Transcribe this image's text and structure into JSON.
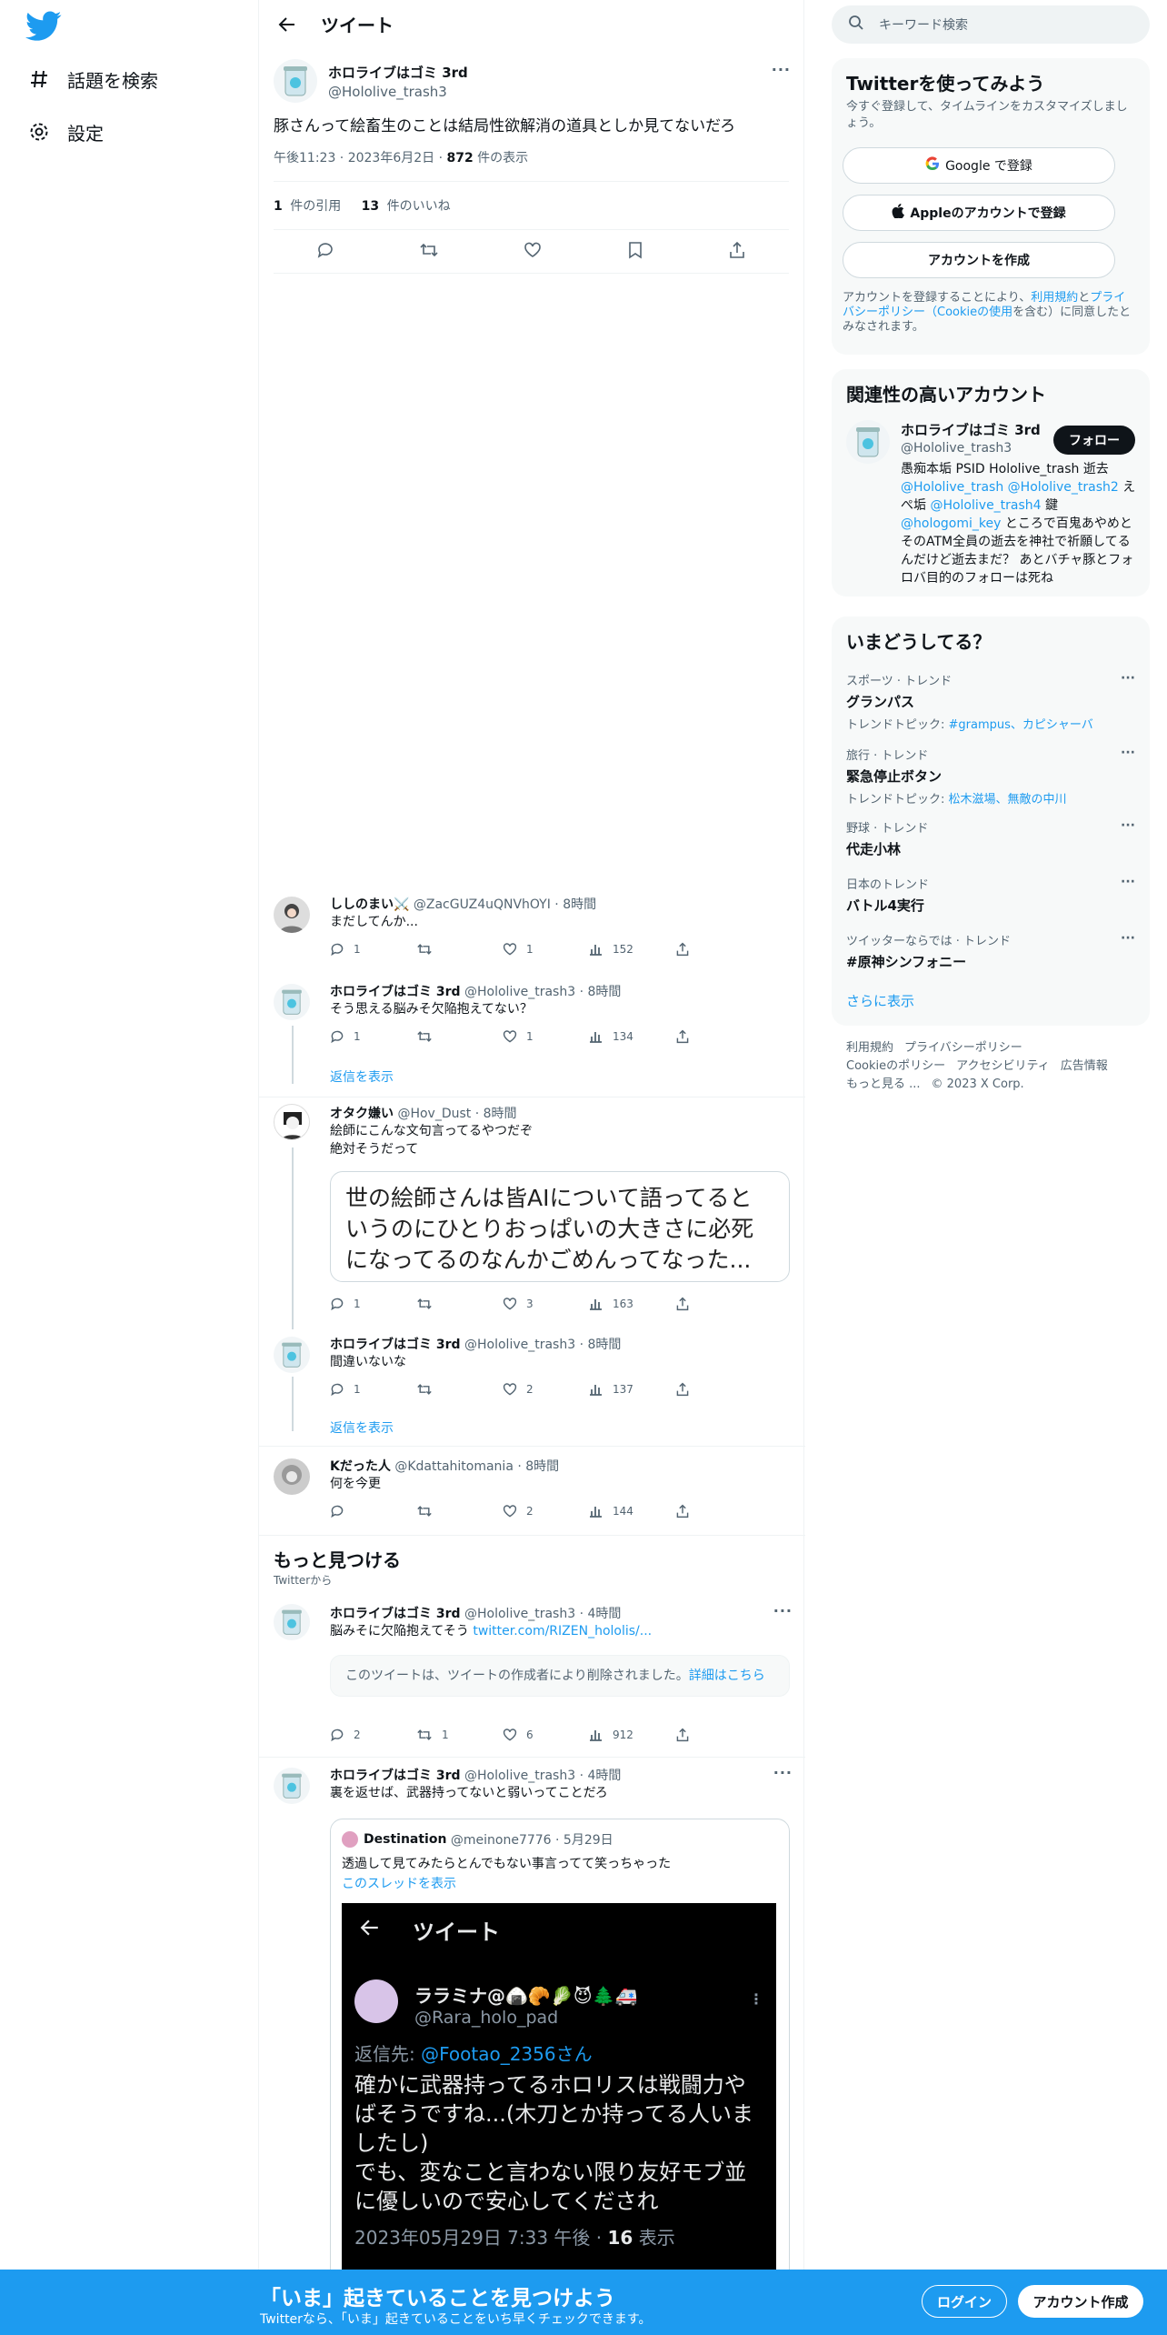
{
  "nav": {
    "explore": "話題を検索",
    "settings": "設定"
  },
  "header": {
    "title": "ツイート"
  },
  "focal": {
    "name": "ホロライブはゴミ 3rd",
    "handle": "@Hololive_trash3",
    "text": "豚さんって絵畜生のことは結局性欲解消の道具としか見てないだろ",
    "time": "午後11:23 · 2023年6月2日 · ",
    "views_num": "872",
    "views_label": " 件の表示",
    "quotes_num": "1",
    "quotes_label": " 件の引用",
    "likes_num": "13",
    "likes_label": " 件のいいね"
  },
  "replies": [
    {
      "name": "ししのまい⚔️",
      "handle": "@ZacGUZ4uQNVhOYI · 8時間",
      "text": "まだしてんか...",
      "reply": "1",
      "retweet": "",
      "like": "1",
      "views": "152"
    },
    {
      "name": "ホロライブはゴミ 3rd",
      "handle": "@Hololive_trash3 · 8時間",
      "text": "そう思える脳みそ欠陥抱えてない？",
      "reply": "1",
      "retweet": "",
      "like": "1",
      "views": "134",
      "show_replies": "返信を表示"
    },
    {
      "name": "オタク嫌い",
      "handle": "@Hov_Dust · 8時間",
      "text1": "絵師にこんな文句言ってるやつだぞ",
      "text2": "絶対そうだって",
      "image_text": "世の絵師さんは皆AIについて語ってるというのにひとりおっぱいの大きさに必死になってるのなんかごめんってなった...",
      "reply": "1",
      "retweet": "",
      "like": "3",
      "views": "163"
    },
    {
      "name": "ホロライブはゴミ 3rd",
      "handle": "@Hololive_trash3 · 8時間",
      "text": "間違いないな",
      "reply": "1",
      "retweet": "",
      "like": "2",
      "views": "137",
      "show_replies": "返信を表示"
    },
    {
      "name": "Kだった人",
      "handle": "@Kdattahitomania · 8時間",
      "text": "何を今更",
      "reply": "",
      "retweet": "",
      "like": "2",
      "views": "144"
    }
  ],
  "discover": {
    "title": "もっと見つける",
    "sub": "Twitterから"
  },
  "more_tweets": [
    {
      "name": "ホロライブはゴミ 3rd",
      "handle": "@Hololive_trash3 · 4時間",
      "text": "脳みそに欠陥抱えてそう ",
      "link": "twitter.com/RIZEN_hololis/...",
      "deleted": "このツイートは、ツイートの作成者により削除されました。",
      "deleted_link": "詳細はこちら",
      "reply": "2",
      "retweet": "1",
      "like": "6",
      "views": "912"
    },
    {
      "name": "ホロライブはゴミ 3rd",
      "handle": "@Hololive_trash3 · 4時間",
      "text": "裏を返せば、武器持ってないと弱いってことだろ",
      "quote": {
        "name": "Destination",
        "handle": "@meinone7776 · 5月29日",
        "text": "透過して見てみたらとんでもない事言ってて笑っちゃった",
        "thread": "このスレッドを表示",
        "shot": {
          "title": "ツイート",
          "name": "ララミナ@🍙🥐🥬😈🌲🚑",
          "handle": "@Rara_holo_pad",
          "reply_to_label": "返信先: ",
          "reply_to": "@Footao_2356さん",
          "body1": "確かに武器持ってるホロリスは戦闘力やばそうですね...(木刀とか持ってる人いましたし)",
          "body2": "でも、変なこと言わない限り友好モブ並に優しいので安心してくだされ",
          "time": "2023年05月29日 7:33 午後 · ",
          "views_num": "16",
          "views_label": " 表示"
        }
      }
    }
  ],
  "search": {
    "placeholder": "キーワード検索"
  },
  "signup_panel": {
    "title": "Twitterを使ってみよう",
    "sub": "今すぐ登録して、タイムラインをカスタマイズしましょう。",
    "google": "Google で登録",
    "apple": "Appleのアカウントで登録",
    "create": "アカウントを作成",
    "legal1": "アカウントを登録することにより、",
    "legal_terms": "利用規約",
    "legal2": "と",
    "legal_privacy": "プライバシーポリシー（Cookieの使用",
    "legal3": "を含む）に同意したとみなされます。"
  },
  "related": {
    "title": "関連性の高いアカウント",
    "name": "ホロライブはゴミ 3rd",
    "handle": "@Hololive_trash3",
    "follow": "フォロー",
    "bio1": "愚痴本垢 PSID Hololive_trash 逝去 ",
    "bio_l1": "@Hololive_trash",
    "bio_sp": " ",
    "bio_l2": "@Hololive_trash2",
    "bio2": " えぺ垢 ",
    "bio_l3": "@Hololive_trash4",
    "bio3": " 鍵 ",
    "bio_l4": "@hologomi_key",
    "bio4": " ところで百鬼あやめとそのATM全員の逝去を神社で祈願してるんだけど逝去まだ？ あとバチャ豚とフォロバ目的のフォローは死ね"
  },
  "trends": {
    "title": "いまどうしてる？",
    "items": [
      {
        "cat": "スポーツ · トレンド",
        "title": "グランパス",
        "sub_label": "トレンドトピック: ",
        "sub_links": "#grampus、カピシャーバ"
      },
      {
        "cat": "旅行 · トレンド",
        "title": "緊急停止ボタン",
        "sub_label": "トレンドトピック: ",
        "sub_links": "松木滋場、無敵の中川"
      },
      {
        "cat": "野球 · トレンド",
        "title": "代走小林"
      },
      {
        "cat": "日本のトレンド",
        "title": "バトル4実行"
      },
      {
        "cat": "ツイッターならでは · トレンド",
        "title": "#原神シンフォニー"
      }
    ],
    "more": "さらに表示"
  },
  "footer": {
    "l1": "利用規約",
    "l2": "プライバシーポリシー",
    "l3": "Cookieのポリシー",
    "l4": "アクセシビリティ",
    "l5": "広告情報",
    "l6": "もっと見る ...",
    "l7": "© 2023 X Corp."
  },
  "bottombar": {
    "title": "「いま」起きていることを見つけよう",
    "sub": "Twitterなら、「いま」起きていることをいち早くチェックできます。",
    "login": "ログイン",
    "signup": "アカウント作成"
  },
  "colors": {
    "accent": "#1d9bf0",
    "text": "#0f1419",
    "muted": "#536471"
  }
}
